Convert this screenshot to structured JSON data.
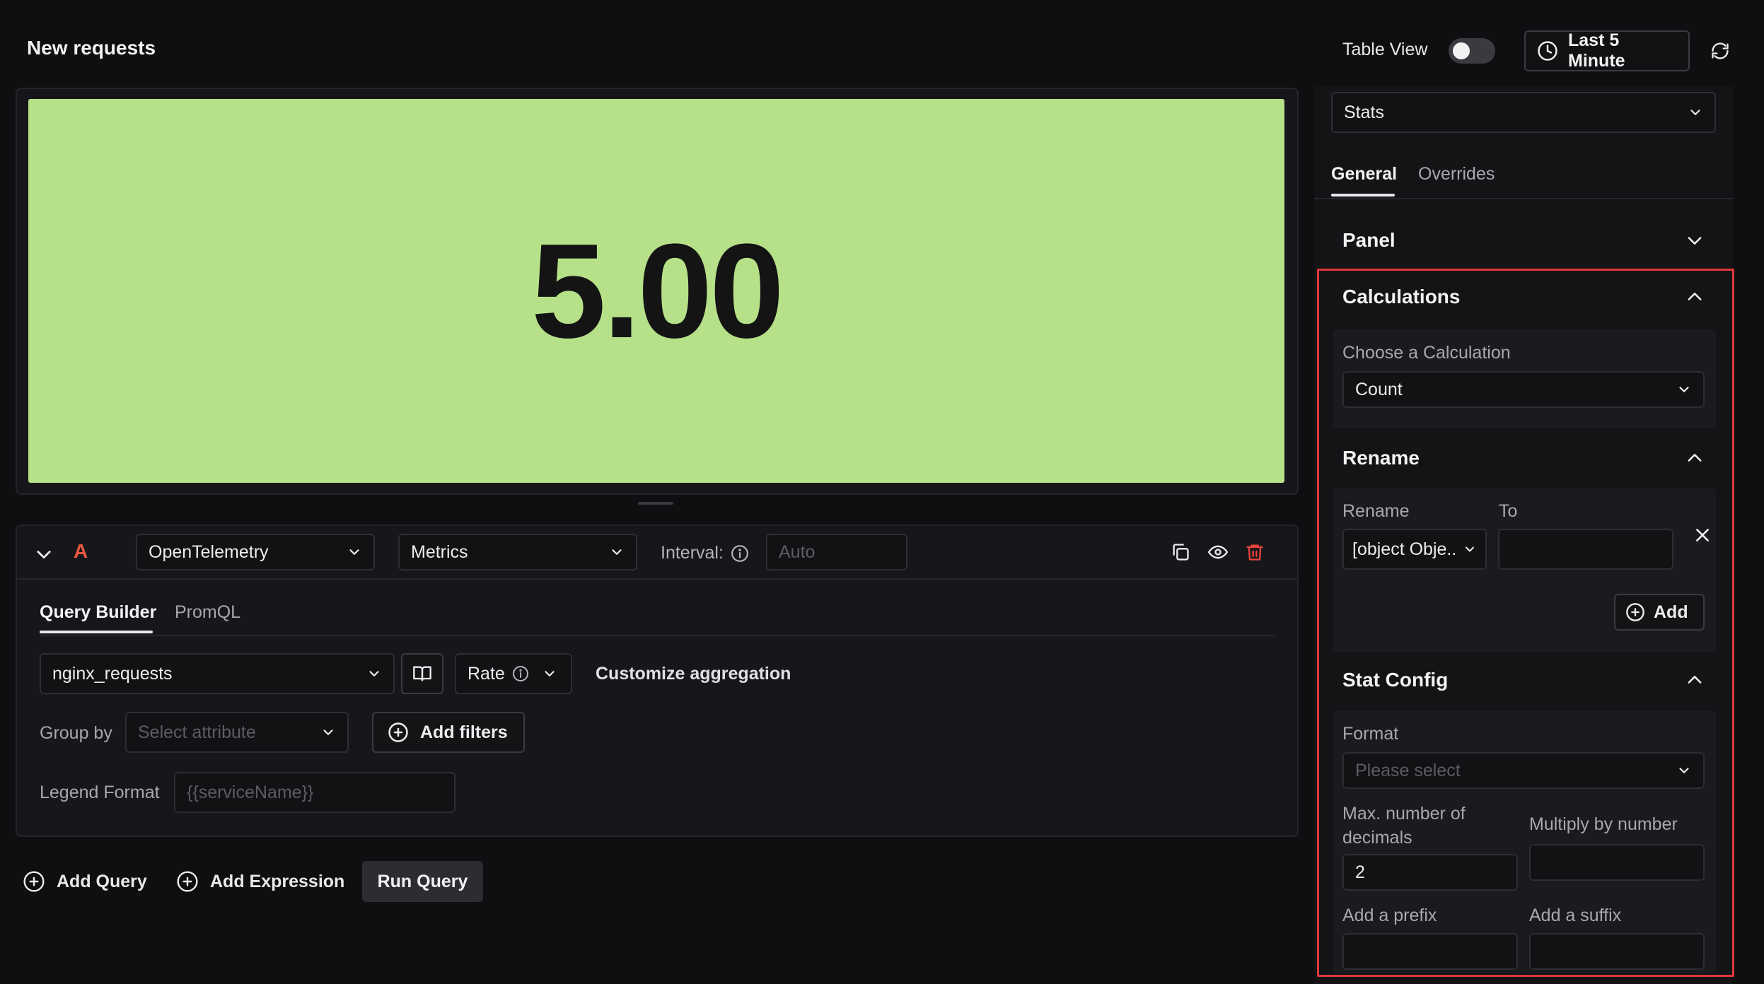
{
  "header": {
    "title": "New requests",
    "table_view_label": "Table View",
    "table_view_on": false,
    "time_range": "Last 5 Minute"
  },
  "stat": {
    "value": "5.00",
    "background": "#b6e188"
  },
  "query": {
    "name": "A",
    "source": "OpenTelemetry",
    "type": "Metrics",
    "interval_label": "Interval:",
    "interval_placeholder": "Auto",
    "tabs": [
      "Query Builder",
      "PromQL"
    ],
    "metric": "nginx_requests",
    "aggregation": "Rate",
    "customize_label": "Customize aggregation",
    "group_by_label": "Group by",
    "group_by_placeholder": "Select attribute",
    "add_filters_label": "Add filters",
    "legend_label": "Legend Format",
    "legend_placeholder": "{{serviceName}}"
  },
  "actions": {
    "add_query": "Add Query",
    "add_expression": "Add Expression",
    "run_query": "Run Query"
  },
  "sidebar": {
    "visualization": "Stats",
    "tabs": [
      "General",
      "Overrides"
    ],
    "panel_title": "Panel",
    "calculations": {
      "title": "Calculations",
      "label": "Choose a Calculation",
      "value": "Count"
    },
    "rename": {
      "title": "Rename",
      "rename_label": "Rename",
      "to_label": "To",
      "rename_value": "[object Obje..",
      "add_label": "Add"
    },
    "stat_config": {
      "title": "Stat Config",
      "format_label": "Format",
      "format_placeholder": "Please select",
      "decimals_label": "Max. number of decimals",
      "decimals_value": "2",
      "multiply_label": "Multiply by number",
      "prefix_label": "Add a prefix",
      "suffix_label": "Add a suffix"
    }
  },
  "colors": {
    "accent_query": "#e8583f",
    "delete": "#e8453c",
    "highlight": "#e0383d"
  }
}
